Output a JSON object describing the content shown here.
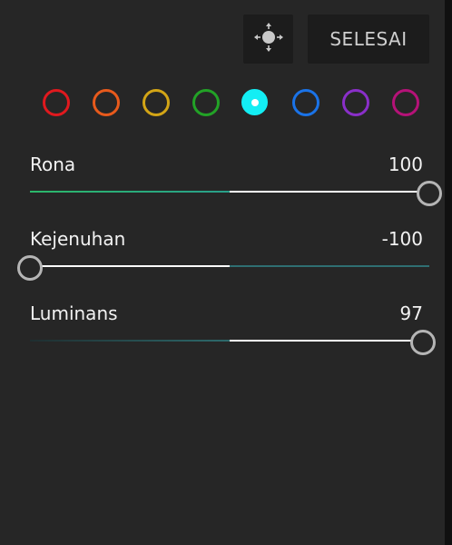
{
  "header": {
    "target_icon": "target-adjust-icon",
    "done_label": "SELESAI"
  },
  "color_swatches": [
    {
      "name": "red",
      "color": "#e0191e",
      "selected": false
    },
    {
      "name": "orange",
      "color": "#e85a1c",
      "selected": false
    },
    {
      "name": "yellow",
      "color": "#d3a516",
      "selected": false
    },
    {
      "name": "green",
      "color": "#22a226",
      "selected": false
    },
    {
      "name": "aqua",
      "color": "#13eef4",
      "selected": true
    },
    {
      "name": "blue",
      "color": "#1a73e8",
      "selected": false
    },
    {
      "name": "purple",
      "color": "#8a2fc9",
      "selected": false
    },
    {
      "name": "magenta",
      "color": "#b51278",
      "selected": false
    }
  ],
  "sliders": [
    {
      "label": "Rona",
      "value": "100",
      "position": 1.0
    },
    {
      "label": "Kejenuhan",
      "value": "-100",
      "position": 0.0
    },
    {
      "label": "Luminans",
      "value": "97",
      "position": 0.985
    }
  ]
}
